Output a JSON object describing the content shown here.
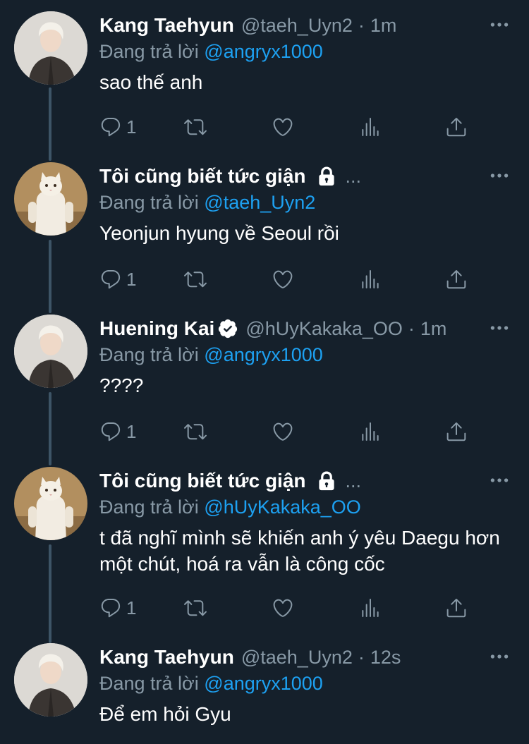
{
  "tweets": [
    {
      "name": "Kang Taehyun",
      "handle": "@taeh_Uyn2",
      "separator": "·",
      "time": "1m",
      "replying_prefix": "Đang trả lời",
      "replying_to": "@angryx1000",
      "text": "sao thế anh",
      "reply_count": "1",
      "avatar": "person-photo"
    },
    {
      "name": "Tôi cũng biết tức giận",
      "name_ellipsis": "...",
      "protected": true,
      "replying_prefix": "Đang trả lời",
      "replying_to": "@taeh_Uyn2",
      "text": "Yeonjun hyung về Seoul rồi",
      "reply_count": "1",
      "avatar": "cat-photo"
    },
    {
      "name": "Huening Kai",
      "verified": true,
      "handle": "@hUyKakaka_OO",
      "separator": "·",
      "time": "1m",
      "replying_prefix": "Đang trả lời",
      "replying_to": "@angryx1000",
      "text": "????",
      "reply_count": "1",
      "avatar": "person-photo"
    },
    {
      "name": "Tôi cũng biết tức giận",
      "name_ellipsis": "...",
      "protected": true,
      "replying_prefix": "Đang trả lời",
      "replying_to": "@hUyKakaka_OO",
      "text": "t đã nghĩ mình sẽ khiến anh ý yêu Daegu hơn một chút, hoá ra vẫn là công cốc",
      "reply_count": "1",
      "avatar": "cat-photo"
    },
    {
      "name": "Kang Taehyun",
      "handle": "@taeh_Uyn2",
      "separator": "·",
      "time": "12s",
      "replying_prefix": "Đang trả lời",
      "replying_to": "@angryx1000",
      "text": "Để em hỏi Gyu",
      "avatar": "person-photo"
    }
  ],
  "colors": {
    "background": "#15202b",
    "secondary_text": "#8899a6",
    "link": "#1da1f2",
    "thread_line": "#3d5466"
  },
  "icons": [
    "reply-icon",
    "retweet-icon",
    "like-icon",
    "analytics-icon",
    "share-icon",
    "more-icon",
    "lock-icon",
    "verified-badge-icon"
  ]
}
